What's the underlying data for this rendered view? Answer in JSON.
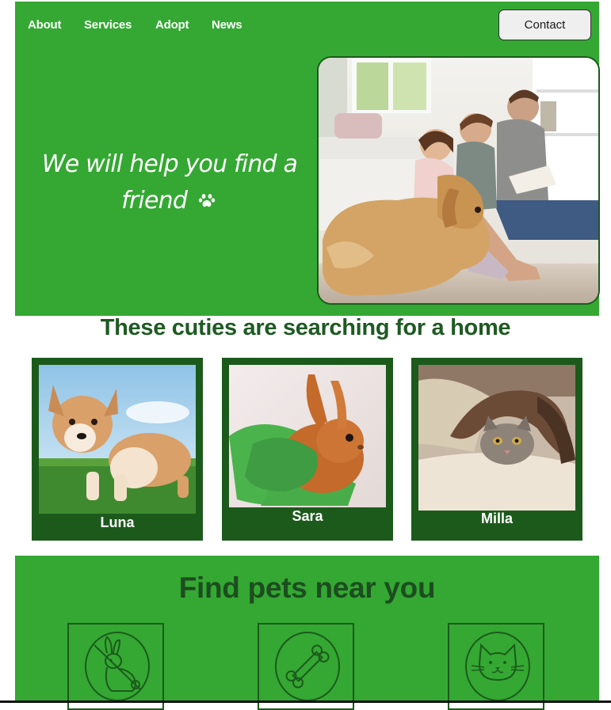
{
  "nav": {
    "items": [
      "About",
      "Services",
      "Adopt",
      "News"
    ],
    "contact_label": "Contact"
  },
  "hero": {
    "tagline_line1": "We will help you find a",
    "tagline_line2": "friend",
    "paw_icon": "paw-icon",
    "photo_subject": "family with golden retriever"
  },
  "cuties": {
    "heading": "These cuties are searching for a home",
    "pets": [
      {
        "name": "Luna",
        "icon": "corgi-puppy-photo"
      },
      {
        "name": "Sara",
        "icon": "rabbit-photo"
      },
      {
        "name": "Milla",
        "icon": "cat-photo"
      }
    ]
  },
  "find": {
    "title": "Find pets near you",
    "categories": [
      "rabbit-icon",
      "bone-icon",
      "cat-icon"
    ]
  },
  "colors": {
    "primary_green": "#34a832",
    "dark_green": "#1c5a1c",
    "heading_green": "#1e5a22"
  }
}
